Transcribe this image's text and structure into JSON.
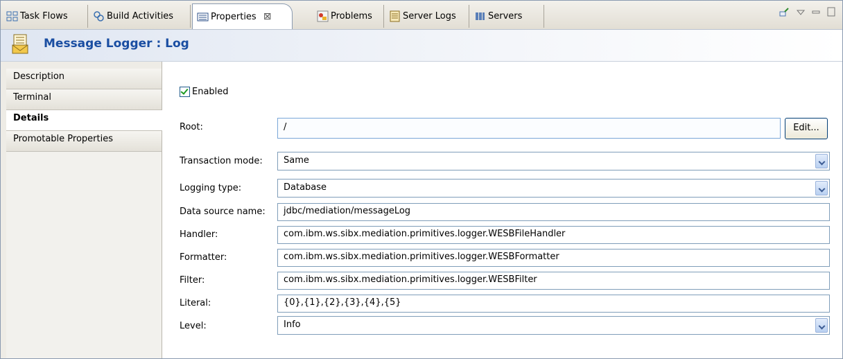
{
  "tabs": [
    {
      "label": "Task Flows",
      "icon": "task-flows-icon"
    },
    {
      "label": "Build Activities",
      "icon": "build-activities-icon"
    },
    {
      "label": "Properties",
      "icon": "properties-icon",
      "active": true,
      "close": "⊠"
    },
    {
      "label": "Problems",
      "icon": "problems-icon"
    },
    {
      "label": "Server Logs",
      "icon": "server-logs-icon"
    },
    {
      "label": "Servers",
      "icon": "servers-icon"
    }
  ],
  "header": {
    "title": "Message Logger : Log",
    "icon": "message-logger-icon"
  },
  "sidebar": {
    "items": [
      {
        "label": "Description"
      },
      {
        "label": "Terminal"
      },
      {
        "label": "Details",
        "selected": true
      },
      {
        "label": "Promotable Properties"
      }
    ]
  },
  "form": {
    "enabled": {
      "label": "Enabled",
      "checked": true
    },
    "root": {
      "label": "Root:",
      "value": "/",
      "button": "Edit..."
    },
    "transaction_mode": {
      "label": "Transaction mode:",
      "value": "Same"
    },
    "logging_type": {
      "label": "Logging type:",
      "value": "Database"
    },
    "data_source_name": {
      "label": "Data source name:",
      "value": "jdbc/mediation/messageLog"
    },
    "handler": {
      "label": "Handler:",
      "value": "com.ibm.ws.sibx.mediation.primitives.logger.WESBFileHandler"
    },
    "formatter": {
      "label": "Formatter:",
      "value": "com.ibm.ws.sibx.mediation.primitives.logger.WESBFormatter"
    },
    "filter": {
      "label": "Filter:",
      "value": "com.ibm.ws.sibx.mediation.primitives.logger.WESBFilter"
    },
    "literal": {
      "label": "Literal:",
      "value": "{0},{1},{2},{3},{4},{5}"
    },
    "level": {
      "label": "Level:",
      "value": "Info"
    }
  },
  "colors": {
    "header_title": "#1a4ea2",
    "checkbox_check": "#1d9a22",
    "field_border": "#7f9db9"
  }
}
